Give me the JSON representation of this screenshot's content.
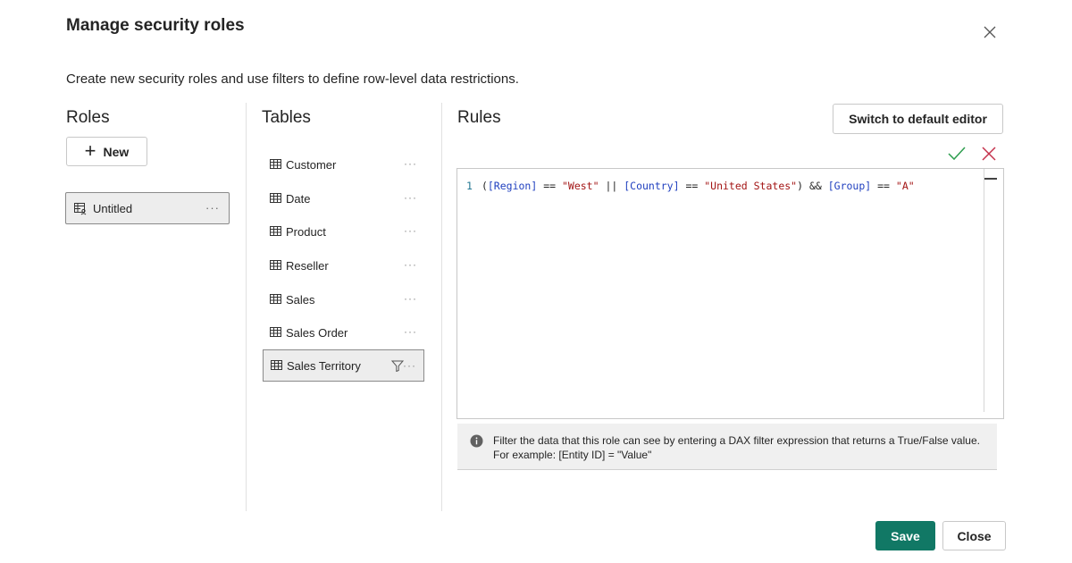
{
  "dialog": {
    "title": "Manage security roles",
    "subtitle": "Create new security roles and use filters to define row-level data restrictions."
  },
  "roles": {
    "heading": "Roles",
    "new_label": "New",
    "items": [
      {
        "label": "Untitled",
        "more": "···"
      }
    ]
  },
  "tables": {
    "heading": "Tables",
    "items": [
      {
        "label": "Customer",
        "more": "···"
      },
      {
        "label": "Date",
        "more": "···"
      },
      {
        "label": "Product",
        "more": "···"
      },
      {
        "label": "Reseller",
        "more": "···"
      },
      {
        "label": "Sales",
        "more": "···"
      },
      {
        "label": "Sales Order",
        "more": "···"
      },
      {
        "label": "Sales Territory",
        "more": "···",
        "selected": true,
        "filtered": true
      }
    ]
  },
  "rules": {
    "heading": "Rules",
    "switch_label": "Switch to default editor",
    "code": {
      "line_number": "1",
      "tokens": [
        {
          "t": "(",
          "k": "o"
        },
        {
          "t": "[Region]",
          "k": "f"
        },
        {
          "t": " == ",
          "k": "o"
        },
        {
          "t": "\"West\"",
          "k": "s"
        },
        {
          "t": " || ",
          "k": "o"
        },
        {
          "t": "[Country]",
          "k": "f"
        },
        {
          "t": " == ",
          "k": "o"
        },
        {
          "t": "\"United States\"",
          "k": "s"
        },
        {
          "t": ") && ",
          "k": "o"
        },
        {
          "t": "[Group]",
          "k": "f"
        },
        {
          "t": " == ",
          "k": "o"
        },
        {
          "t": "\"A\"",
          "k": "s"
        }
      ]
    },
    "info_text": "Filter the data that this role can see by entering a DAX filter expression that returns a True/False value. For example: [Entity ID] = \"Value\""
  },
  "footer": {
    "save_label": "Save",
    "close_label": "Close"
  },
  "colors": {
    "accent": "#117865",
    "confirm": "#2e9e4f",
    "cancel": "#c4314b"
  }
}
